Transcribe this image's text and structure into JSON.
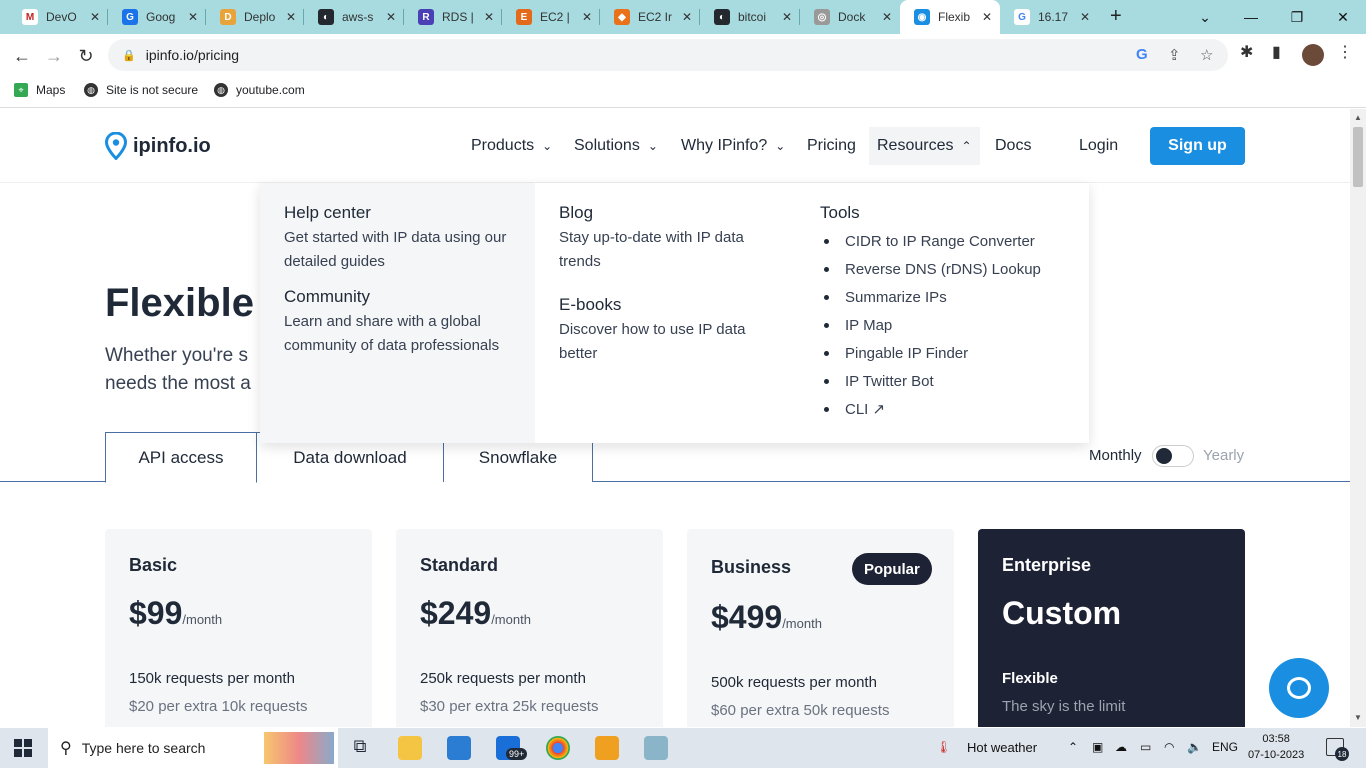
{
  "browser": {
    "tabs": [
      {
        "title": "DevO",
        "color": "#c5221f",
        "glyph": "M"
      },
      {
        "title": "Goog",
        "color": "#1a73e8",
        "glyph": "G"
      },
      {
        "title": "Deplo",
        "color": "#e8a33a",
        "glyph": "D"
      },
      {
        "title": "aws-s",
        "color": "#24292f",
        "glyph": "◐"
      },
      {
        "title": "RDS |",
        "color": "#4a3fb5",
        "glyph": "R"
      },
      {
        "title": "EC2 |",
        "color": "#e36a1a",
        "glyph": "E"
      },
      {
        "title": "EC2 Ir",
        "color": "#e8711a",
        "glyph": "◆"
      },
      {
        "title": "bitcoi",
        "color": "#24292f",
        "glyph": "◐"
      },
      {
        "title": "Dock",
        "color": "#999999",
        "glyph": "◎"
      },
      {
        "title": "Flexib",
        "color": "#1a8ee0",
        "glyph": "◉"
      },
      {
        "title": "16.17",
        "color": "#ffffff",
        "glyph": "G"
      }
    ],
    "url": "ipinfo.io/pricing",
    "bookmarks": [
      "Maps",
      "Site is not secure",
      "youtube.com"
    ]
  },
  "header": {
    "logo": "ipinfo.io",
    "nav": [
      "Products",
      "Solutions",
      "Why IPinfo?",
      "Pricing",
      "Resources",
      "Docs"
    ],
    "login": "Login",
    "signup": "Sign up"
  },
  "hero": {
    "title": "Flexible",
    "sub1": "Whether you're s",
    "sub2": "needs the most a"
  },
  "resources_menu": {
    "help_title": "Help center",
    "help_desc": "Get started with IP data using our detailed guides",
    "community_title": "Community",
    "community_desc": "Learn and share with a global community of data professionals",
    "blog_title": "Blog",
    "blog_desc": "Stay up-to-date with IP data trends",
    "ebooks_title": "E-books",
    "ebooks_desc": "Discover how to use IP data better",
    "tools_title": "Tools",
    "tools": [
      "CIDR to IP Range Converter",
      "Reverse DNS (rDNS) Lookup",
      "Summarize IPs",
      "IP Map",
      "Pingable IP Finder",
      "IP Twitter Bot",
      "CLI ↗"
    ]
  },
  "plan_tabs": [
    "API access",
    "Data download",
    "Snowflake"
  ],
  "billing": {
    "monthly": "Monthly",
    "yearly": "Yearly"
  },
  "plans": [
    {
      "name": "Basic",
      "price": "$99",
      "per": "/month",
      "requests": "150k requests per month",
      "extra": "$20 per extra 10k requests"
    },
    {
      "name": "Standard",
      "price": "$249",
      "per": "/month",
      "requests": "250k requests per month",
      "extra": "$30 per extra 25k requests"
    },
    {
      "name": "Business",
      "price": "$499",
      "per": "/month",
      "requests": "500k requests per month",
      "extra": "$60 per extra 50k requests",
      "badge": "Popular"
    },
    {
      "name": "Enterprise",
      "price": "Custom",
      "requests": "Flexible",
      "extra": "The sky is the limit"
    }
  ],
  "taskbar": {
    "search": "Type here to search",
    "weather": "Hot weather",
    "lang": "ENG",
    "time": "03:58",
    "date": "07-10-2023",
    "badge": "99+",
    "notifications": "18"
  }
}
